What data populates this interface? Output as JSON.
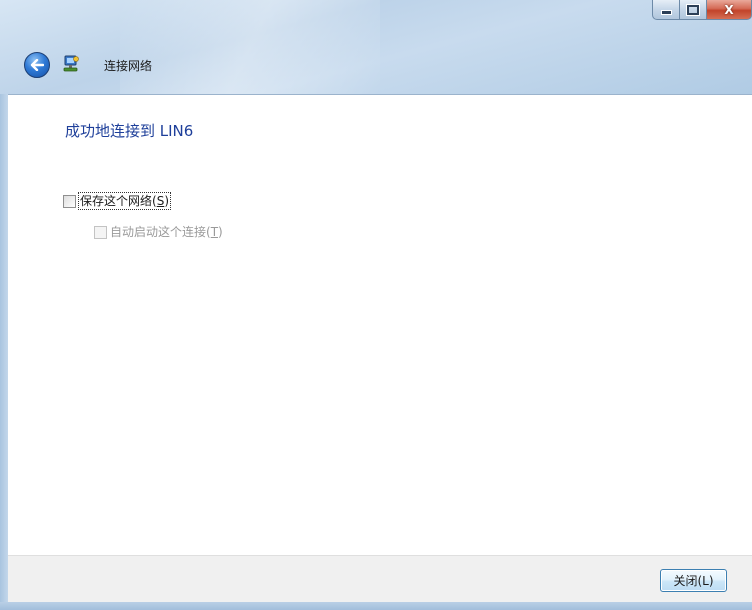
{
  "window": {
    "title": "连接网络",
    "caption": {
      "minimize_icon": "minimize-icon",
      "maximize_icon": "maximize-icon",
      "close_glyph": "X"
    }
  },
  "header": {
    "back_icon": "back-arrow-icon",
    "app_icon": "network-connection-icon"
  },
  "content": {
    "heading": "成功地连接到 LIN6",
    "save_network": {
      "text": "保存这个网络(",
      "key": "S",
      "end": ")",
      "checked": false
    },
    "auto_start": {
      "text": "自动启动这个连接(",
      "key": "T",
      "end": ")",
      "checked": false,
      "disabled": true
    }
  },
  "footer": {
    "close_label": "关闭(L)"
  },
  "colors": {
    "heading": "#1e3f9a",
    "frame": "#b8d0e6",
    "close_button_border": "#3c7fb1"
  }
}
